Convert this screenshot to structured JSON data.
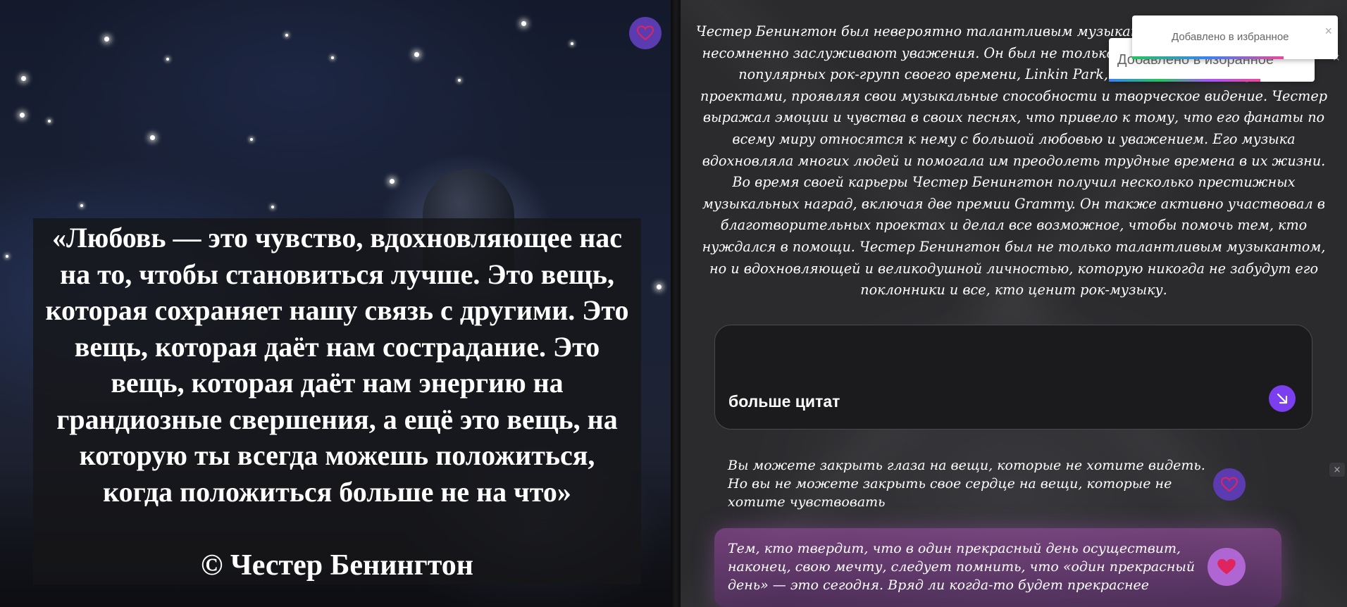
{
  "hero": {
    "quote": "«Любовь — это чувство, вдохновляющее нас на то, чтобы становиться лучше. Это вещь, которая сохраняет нашу связь с другими. Это вещь, которая даёт нам сострадание. Это вещь, которая даёт нам энергию на грандиозные свершения, а ещё это вещь, на которую ты всегда можешь положиться, когда положиться больше не на что»",
    "author": "© Честер Бенингтон",
    "favorite_icon": "heart-outline-icon"
  },
  "bio": {
    "text": "Честер Бенингтон был невероятно талантливым музыкантом, и его вклад в музыке несомненно заслуживают уважения. Он был не только участником одной из самых популярных рок-групп своего времени, Linkin Park, но и занимался другими проектами, проявляя свои музыкальные способности и творческое видение. Честер выражал эмоции и чувства в своих песнях, что привело к тому, что его фанаты по всему миру относятся к нему с большой любовью и уважением. Его музыка вдохновляла многих людей и помогала им преодолеть трудные времена в их жизни. Во время своей карьеры Честер Бенингтон получил несколько престижных музыкальных наград, включая две премии Grammy. Он также активно участвовал в благотворительных проектах и делал все возможное, чтобы помочь тем, кто нуждался в помощи. Честер Бенингтон был не только талантливым музыкантом, но и вдохновляющей и великодушной личностью, которую никогда не забудут его поклонники и все, кто ценит рок-музыку."
  },
  "more_card": {
    "label": "больше цитат",
    "icon": "arrow-down-right-icon"
  },
  "quotes": [
    {
      "text": "Вы можете закрыть глаза на вещи, которые не хотите видеть. Но вы не можете закрыть свое сердце на вещи, которые не хотите чувствовать",
      "favorited": false
    },
    {
      "text": "Тем, кто твердит, что в один прекрасный день осуществит, наконец, свою мечту, следует помнить, что «один прекрасный день» — это сегодня. Вряд ли когда-то будет прекраснее",
      "favorited": true
    }
  ],
  "toasts": [
    {
      "message": "Добавлено в избранное",
      "close": "×"
    },
    {
      "message": "Добавлено в избранное",
      "close": "×"
    }
  ],
  "side_icon": "×",
  "colors": {
    "accent_purple": "#7b3ff0",
    "heart_red": "#e0245e",
    "panel_bg": "#2b2b2e"
  }
}
